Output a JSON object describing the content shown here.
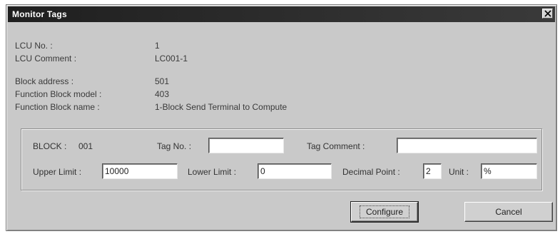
{
  "window": {
    "title": "Monitor Tags"
  },
  "info": {
    "lcu_no_label": "LCU No. :",
    "lcu_no_value": "1",
    "lcu_comment_label": "LCU Comment :",
    "lcu_comment_value": "LC001-1",
    "block_address_label": "Block address :",
    "block_address_value": "501",
    "fb_model_label": "Function Block model :",
    "fb_model_value": "403",
    "fb_name_label": "Function Block name :",
    "fb_name_value": "1-Block Send Terminal to Compute"
  },
  "block": {
    "label": "BLOCK :",
    "value": "001",
    "tag_no_label": "Tag No. :",
    "tag_no_value": "",
    "tag_comment_label": "Tag Comment :",
    "tag_comment_value": "",
    "upper_limit_label": "Upper Limit :",
    "upper_limit_value": "10000",
    "lower_limit_label": "Lower Limit :",
    "lower_limit_value": "0",
    "decimal_point_label": "Decimal Point :",
    "decimal_point_value": "2",
    "unit_label": "Unit :",
    "unit_value": "%"
  },
  "buttons": {
    "configure_label": "Configure",
    "cancel_label": "Cancel"
  },
  "icons": {
    "close": "close-icon"
  }
}
